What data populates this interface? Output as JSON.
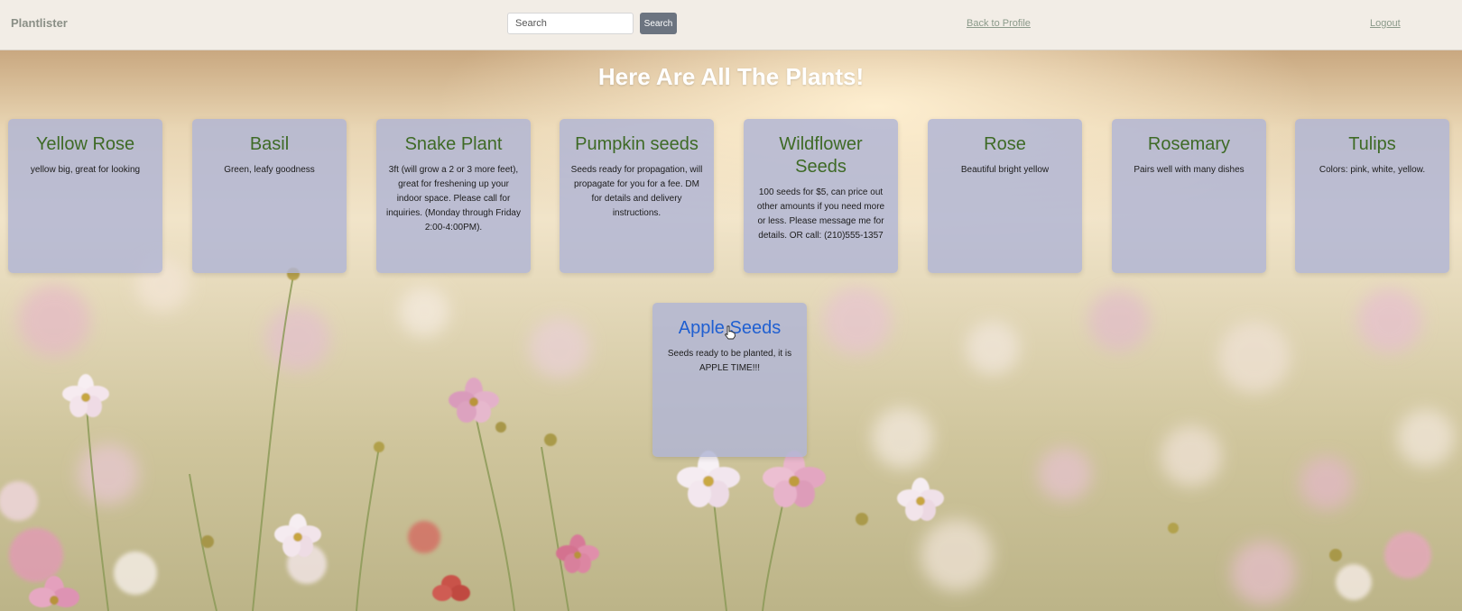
{
  "navbar": {
    "brand": "Plantlister",
    "search_placeholder": "Search",
    "search_value": "",
    "search_button": "Search",
    "back_to_profile": "Back to Profile",
    "logout": "Logout"
  },
  "page": {
    "title": "Here Are All The Plants!"
  },
  "plants": [
    {
      "name": "Yellow Rose",
      "description": "yellow big, great for looking"
    },
    {
      "name": "Basil",
      "description": "Green, leafy goodness"
    },
    {
      "name": "Snake Plant",
      "description": "3ft (will grow a 2 or 3 more feet), great for freshening up your indoor space. Please call for inquiries. (Monday through Friday 2:00-4:00PM)."
    },
    {
      "name": "Pumpkin seeds",
      "description": "Seeds ready for propagation, will propagate for you for a fee. DM for details and delivery instructions."
    },
    {
      "name": "Wildflower Seeds",
      "description": "100 seeds for $5, can price out other amounts if you need more or less. Please message me for details. OR call: (210)555-1357"
    },
    {
      "name": "Rose",
      "description": "Beautiful bright yellow"
    },
    {
      "name": "Rosemary",
      "description": "Pairs well with many dishes"
    },
    {
      "name": "Tulips",
      "description": "Colors: pink, white, yellow."
    },
    {
      "name": "Apple Seeds",
      "description": "Seeds ready to be planted, it is APPLE TIME!!!"
    }
  ],
  "colors": {
    "card_background": "#b0b4d4",
    "card_title": "#3e6a26",
    "card_title_hover": "#1f5fd1",
    "navbar_background": "#f2ede6",
    "search_button": "#6c7480"
  }
}
